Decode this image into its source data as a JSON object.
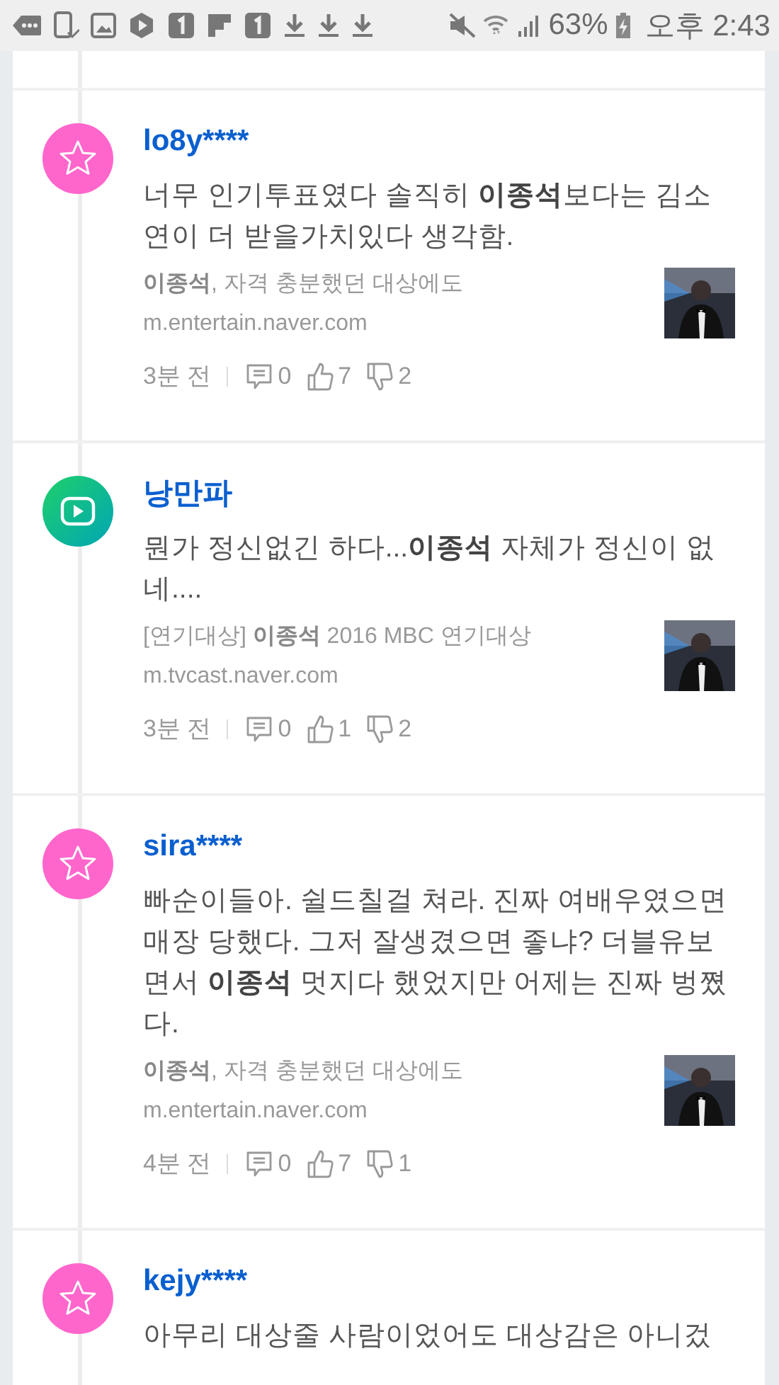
{
  "status_bar": {
    "battery": "63%",
    "time": "오후 2:43"
  },
  "comments": [
    {
      "author": "lo8y****",
      "avatar": {
        "kind": "star"
      },
      "body": "너무 인기투표였다 솔직히 **이종석**보다는 김소연이 더 받을가치있다 생각함.",
      "link": {
        "title": "**이종석**, 자격 충분했던 대상에도",
        "url": "m.entertain.naver.com"
      },
      "time": "3분 전",
      "replies": "0",
      "likes": "7",
      "dislikes": "2"
    },
    {
      "author": "낭만파",
      "avatar": {
        "kind": "video"
      },
      "body": "뭔가 정신없긴 하다...**이종석** 자체가 정신이 없네....",
      "link": {
        "title": "[연기대상] **이종석** 2016 MBC 연기대상",
        "url": "m.tvcast.naver.com"
      },
      "time": "3분 전",
      "replies": "0",
      "likes": "1",
      "dislikes": "2"
    },
    {
      "author": "sira****",
      "avatar": {
        "kind": "star"
      },
      "body": "빠순이들아. 쉴드칠걸 쳐라. 진짜 여배우였으면 매장 당했다. 그저 잘생겼으면 좋냐? 더블유보면서 **이종석** 멋지다 했었지만 어제는 진짜 벙쪘다.",
      "link": {
        "title": "**이종석**, 자격 충분했던 대상에도",
        "url": "m.entertain.naver.com"
      },
      "time": "4분 전",
      "replies": "0",
      "likes": "7",
      "dislikes": "1"
    },
    {
      "author": "kejy****",
      "avatar": {
        "kind": "star"
      },
      "body": "아무리 대상줄 사람이었어도 대상감은 아니겄"
    }
  ]
}
